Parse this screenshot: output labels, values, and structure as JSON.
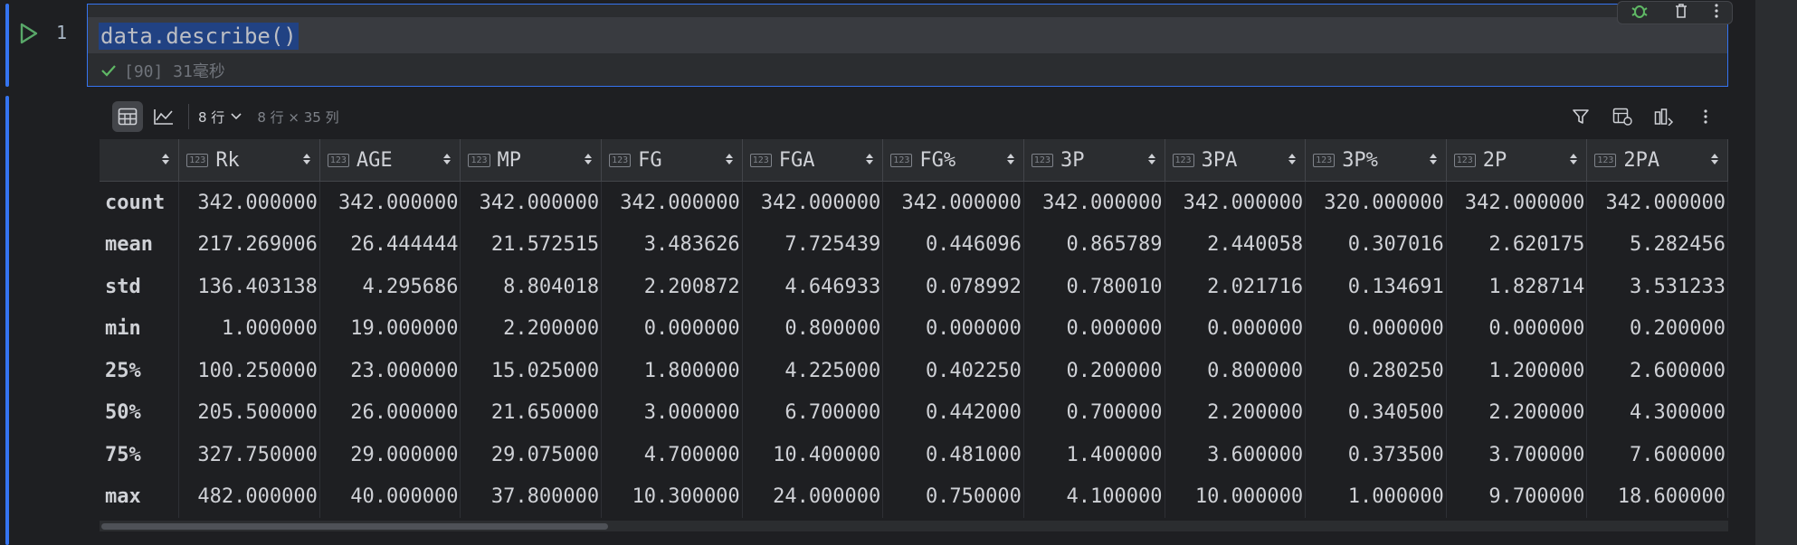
{
  "cell": {
    "line_number": "1",
    "code": "data.describe()",
    "status": "[90] 31毫秒"
  },
  "output": {
    "rows_selector": "8 行",
    "dimensions": "8 行 × 35 列",
    "type_badge": "123",
    "columns": [
      "Rk",
      "AGE",
      "MP",
      "FG",
      "FGA",
      "FG%",
      "3P",
      "3PA",
      "3P%",
      "2P",
      "2PA"
    ],
    "rows": [
      {
        "index": "count",
        "values": [
          "342.000000",
          "342.000000",
          "342.000000",
          "342.000000",
          "342.000000",
          "342.000000",
          "342.000000",
          "342.000000",
          "320.000000",
          "342.000000",
          "342.000000"
        ]
      },
      {
        "index": "mean",
        "values": [
          "217.269006",
          "26.444444",
          "21.572515",
          "3.483626",
          "7.725439",
          "0.446096",
          "0.865789",
          "2.440058",
          "0.307016",
          "2.620175",
          "5.282456"
        ]
      },
      {
        "index": "std",
        "values": [
          "136.403138",
          "4.295686",
          "8.804018",
          "2.200872",
          "4.646933",
          "0.078992",
          "0.780010",
          "2.021716",
          "0.134691",
          "1.828714",
          "3.531233"
        ]
      },
      {
        "index": "min",
        "values": [
          "1.000000",
          "19.000000",
          "2.200000",
          "0.000000",
          "0.800000",
          "0.000000",
          "0.000000",
          "0.000000",
          "0.000000",
          "0.000000",
          "0.200000"
        ]
      },
      {
        "index": "25%",
        "values": [
          "100.250000",
          "23.000000",
          "15.025000",
          "1.800000",
          "4.225000",
          "0.402250",
          "0.200000",
          "0.800000",
          "0.280250",
          "1.200000",
          "2.600000"
        ]
      },
      {
        "index": "50%",
        "values": [
          "205.500000",
          "26.000000",
          "21.650000",
          "3.000000",
          "6.700000",
          "0.442000",
          "0.700000",
          "2.200000",
          "0.340500",
          "2.200000",
          "4.300000"
        ]
      },
      {
        "index": "75%",
        "values": [
          "327.750000",
          "29.000000",
          "29.075000",
          "4.700000",
          "10.400000",
          "0.481000",
          "1.400000",
          "3.600000",
          "0.373500",
          "3.700000",
          "7.600000"
        ]
      },
      {
        "index": "max",
        "values": [
          "482.000000",
          "40.000000",
          "37.800000",
          "10.300000",
          "24.000000",
          "0.750000",
          "4.100000",
          "10.000000",
          "1.000000",
          "9.700000",
          "18.600000"
        ]
      }
    ]
  },
  "icons": {
    "run": "run-icon",
    "success": "check-icon",
    "debug": "bug-icon",
    "delete": "trash-icon",
    "more": "more-vertical-icon",
    "table_view": "table-icon",
    "chart_view": "chart-icon",
    "filter": "filter-icon",
    "export": "table-export-icon",
    "columns": "columns-icon"
  },
  "colors": {
    "accent": "#3574f0",
    "success": "#5fb865",
    "run": "#59a869"
  }
}
